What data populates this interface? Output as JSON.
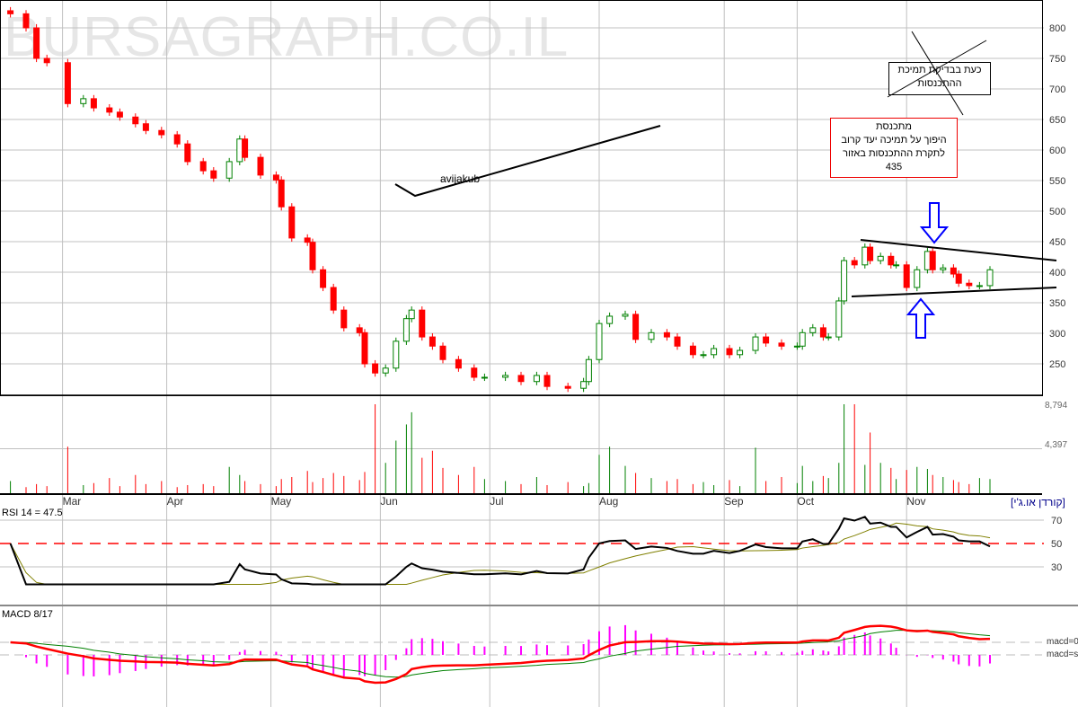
{
  "watermark": "BURSAGRAPH.CO.IL",
  "security_label": "[קורדן או.ג'י]",
  "rsi_label": "RSI 14 = 47.5",
  "macd_label": "MACD 8/17",
  "macd_zero_label": "macd=0",
  "macd_signal_label": "macd=s",
  "annotations": {
    "author": "avijakub",
    "crossed_note": [
      "כעת בבדיקת תמיכת",
      "ההתכנסות"
    ],
    "red_note": [
      "מתכנסת",
      "היפוך על תמיכה יעד קרוב",
      "לתקרת ההתכנסות באזור",
      "435"
    ]
  },
  "colors": {
    "up": "#008000",
    "down": "#ff0000",
    "rsi": "#000000",
    "rsi_ma": "#808000",
    "macd": "#ff0000",
    "signal": "#008000",
    "hist": "#ff00ff",
    "arrow": "#0000ff"
  },
  "chart_data": {
    "type": "candlestick",
    "price_ticks": [
      800,
      750,
      700,
      650,
      600,
      550,
      500,
      450,
      400,
      350,
      300,
      250
    ],
    "volume_ticks": [
      "8,794",
      "4,397"
    ],
    "volume_max": 8794,
    "rsi_ticks": [
      70,
      50,
      30
    ],
    "months": [
      {
        "label": "Mar",
        "day": 12
      },
      {
        "label": "Apr",
        "day": 32
      },
      {
        "label": "May",
        "day": 52
      },
      {
        "label": "Jun",
        "day": 73
      },
      {
        "label": "Jul",
        "day": 94
      },
      {
        "label": "Aug",
        "day": 115
      },
      {
        "label": "Sep",
        "day": 139
      },
      {
        "label": "Oct",
        "day": 153
      },
      {
        "label": "Nov",
        "day": 174
      }
    ],
    "days": [
      2,
      5,
      7,
      9,
      13,
      16,
      18,
      21,
      23,
      26,
      28,
      31,
      34,
      36,
      39,
      41,
      44,
      46,
      47,
      50,
      53,
      54,
      56,
      59,
      60,
      62,
      64,
      66,
      69,
      70,
      72,
      74,
      76,
      78,
      79,
      81,
      83,
      85,
      88,
      91,
      93,
      97,
      100,
      103,
      105,
      109,
      112,
      113,
      115,
      117,
      120,
      122,
      125,
      128,
      130,
      133,
      135,
      137,
      140,
      142,
      145,
      147,
      150,
      153,
      154,
      156,
      158,
      159,
      161,
      162,
      164,
      166,
      167,
      169,
      171,
      172,
      174,
      176,
      178,
      179,
      181,
      183,
      184,
      186,
      188,
      190
    ],
    "close": [
      823,
      800,
      750,
      743,
      676,
      684,
      669,
      662,
      654,
      643,
      632,
      625,
      610,
      581,
      566,
      554,
      581,
      618,
      588,
      559,
      551,
      507,
      456,
      449,
      404,
      375,
      338,
      309,
      301,
      250,
      235,
      243,
      287,
      324,
      338,
      294,
      279,
      257,
      243,
      228,
      228,
      231,
      221,
      231,
      213,
      210,
      221,
      257,
      316,
      328,
      331,
      290,
      301,
      294,
      279,
      265,
      265,
      275,
      265,
      272,
      294,
      284,
      279,
      279,
      301,
      309,
      294,
      294,
      353,
      419,
      412,
      441,
      419,
      426,
      412,
      412,
      375,
      404,
      434,
      404,
      407,
      397,
      382,
      378,
      378,
      404
    ],
    "volume": [
      1200,
      600,
      900,
      700,
      4600,
      800,
      1000,
      1500,
      700,
      1800,
      900,
      1200,
      600,
      800,
      900,
      700,
      2600,
      1800,
      1200,
      900,
      700,
      1400,
      1600,
      2200,
      1100,
      1500,
      2000,
      1700,
      1300,
      2100,
      8794,
      3000,
      5200,
      6800,
      8000,
      3500,
      4200,
      2500,
      1800,
      2600,
      1400,
      1200,
      900,
      1600,
      800,
      1100,
      700,
      1000,
      3800,
      4600,
      2700,
      2000,
      1500,
      1200,
      1400,
      900,
      1100,
      800,
      1300,
      700,
      4500,
      1200,
      1600,
      1000,
      2700,
      1200,
      1700,
      1500,
      3000,
      8794,
      8794,
      2800,
      6000,
      3000,
      2500,
      1400,
      2300,
      2600,
      2400,
      1800,
      1600,
      1300,
      1100,
      900,
      1500,
      1400
    ],
    "rsi_period": 14,
    "rsi_last": 47.5,
    "macd_fast": 8,
    "macd_slow": 17
  }
}
